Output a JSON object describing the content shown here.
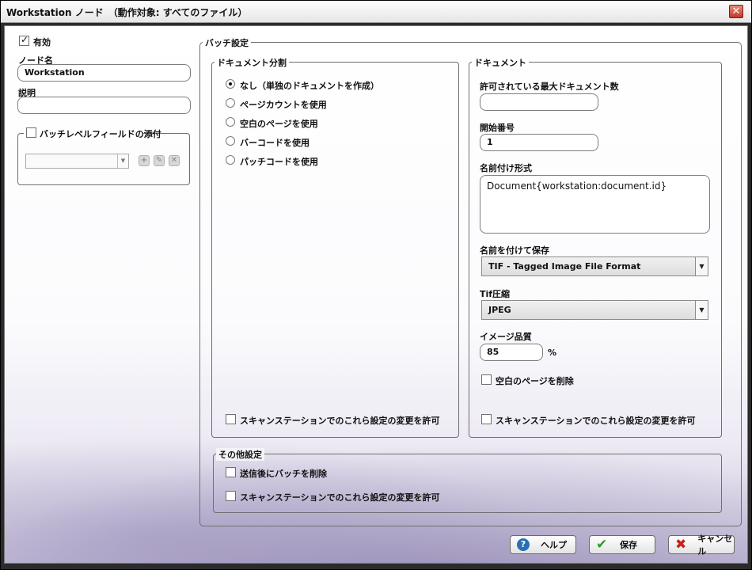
{
  "window": {
    "title": "Workstation ノード　（動作対象: すべてのファイル）",
    "close_glyph": "✕"
  },
  "left": {
    "enabled_label": "有効",
    "enabled_checked": true,
    "node_name_label": "ノード名",
    "node_name_value": "Workstation",
    "description_label": "説明",
    "description_value": "",
    "batch_fields_legend": "バッチレベルフィールドの添付",
    "batch_fields_checked": false,
    "combo_value": ""
  },
  "batch": {
    "legend": "バッチ設定",
    "split": {
      "legend": "ドキュメント分割",
      "options": [
        {
          "label": "なし（単独のドキュメントを作成）",
          "checked": true
        },
        {
          "label": "ページカウントを使用",
          "checked": false
        },
        {
          "label": "空白のページを使用",
          "checked": false
        },
        {
          "label": "バーコードを使用",
          "checked": false
        },
        {
          "label": "パッチコードを使用",
          "checked": false
        }
      ],
      "allow_label": "スキャンステーションでのこれら設定の変更を許可"
    },
    "document": {
      "legend": "ドキュメント",
      "max_docs_label": "許可されている最大ドキュメント数",
      "max_docs_value": "",
      "start_label": "開始番号",
      "start_value": "1",
      "naming_label": "名前付け形式",
      "naming_value": "Document{workstation:document.id}",
      "save_as_label": "名前を付けて保存",
      "save_as_value": "TIF - Tagged Image File Format",
      "tif_label": "Tif圧縮",
      "tif_value": "JPEG",
      "quality_label": "イメージ品質",
      "quality_value": "85",
      "quality_unit": "%",
      "delete_blank_label": "空白のページを削除",
      "allow_label": "スキャンステーションでのこれら設定の変更を許可"
    },
    "other": {
      "legend": "その他設定",
      "delete_after_label": "送信後にバッチを削除",
      "allow_label": "スキャンステーションでのこれら設定の変更を許可"
    }
  },
  "footer": {
    "help_label": "ヘルプ",
    "save_label": "保存",
    "cancel_label": "キャンセル"
  },
  "icons": {
    "help": "?",
    "save": "✔",
    "cancel": "✖",
    "combo_arrow": "▼",
    "add": "+",
    "edit": "✎",
    "remove": "✕"
  }
}
